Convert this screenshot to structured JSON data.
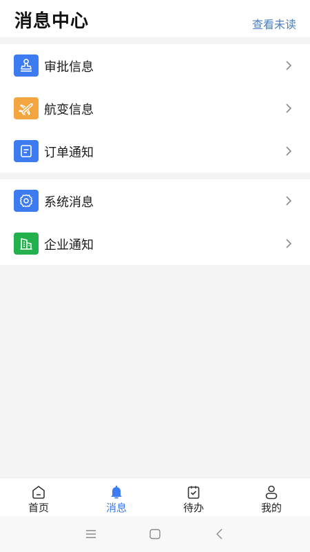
{
  "header": {
    "title": "消息中心",
    "view_unread": "查看未读"
  },
  "groups": [
    {
      "items": [
        {
          "label": "审批信息",
          "icon": "stamp-icon",
          "color": "#3d7bf0"
        },
        {
          "label": "航变信息",
          "icon": "airplane-icon",
          "color": "#f3a640"
        },
        {
          "label": "订单通知",
          "icon": "document-icon",
          "color": "#3d7bf0"
        }
      ]
    },
    {
      "items": [
        {
          "label": "系统消息",
          "icon": "gear-icon",
          "color": "#3d7bf0"
        },
        {
          "label": "企业通知",
          "icon": "building-icon",
          "color": "#22b14c"
        }
      ]
    }
  ],
  "tabbar": {
    "tabs": [
      {
        "label": "首页",
        "icon": "home-icon"
      },
      {
        "label": "消息",
        "icon": "bell-icon",
        "active": true
      },
      {
        "label": "待办",
        "icon": "clipboard-check-icon"
      },
      {
        "label": "我的",
        "icon": "person-icon"
      }
    ],
    "active_color": "#3d7bf0"
  },
  "system_nav": {
    "buttons": [
      "menu-icon",
      "home-square-icon",
      "back-icon"
    ]
  }
}
